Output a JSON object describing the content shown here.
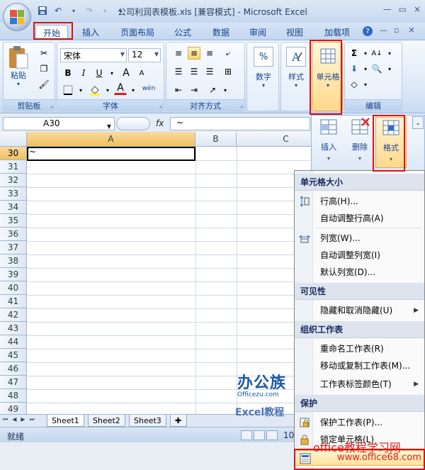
{
  "title_bar": {
    "title": "公司利润表模板.xls [兼容模式] - Microsoft Excel",
    "minimize": "—",
    "restore": "▭",
    "close": "×"
  },
  "tabs": [
    {
      "label": "开始",
      "active": true
    },
    {
      "label": "插入",
      "active": false
    },
    {
      "label": "页面布局",
      "active": false
    },
    {
      "label": "公式",
      "active": false
    },
    {
      "label": "数据",
      "active": false
    },
    {
      "label": "审阅",
      "active": false
    },
    {
      "label": "视图",
      "active": false
    },
    {
      "label": "加载项",
      "active": false
    }
  ],
  "ribbon": {
    "clipboard": {
      "label": "剪贴板",
      "paste": "粘贴"
    },
    "font": {
      "label": "字体",
      "font_name": "宋体",
      "font_size": "12",
      "bold": "B",
      "italic": "I",
      "underline": "U",
      "grow": "A",
      "shrink": "A",
      "font_color_letter": "A",
      "phonetic": "wén"
    },
    "alignment": {
      "label": "对齐方式"
    },
    "number": {
      "label": "数字",
      "symbol": "%"
    },
    "styles": {
      "label": "样式"
    },
    "cells": {
      "label": "单元格"
    },
    "editing": {
      "label": "编辑"
    }
  },
  "formula_bar": {
    "name_box": "A30",
    "fx": "fx",
    "content": "~"
  },
  "cells_panel": {
    "insert": "插入",
    "delete": "删除",
    "format": "格式"
  },
  "grid": {
    "columns": [
      "A",
      "B",
      "C"
    ],
    "rows": [
      "30",
      "31",
      "32",
      "33",
      "34",
      "35",
      "36",
      "37",
      "38",
      "39",
      "40",
      "41",
      "42",
      "43",
      "44",
      "45",
      "46",
      "47",
      "48",
      "49"
    ],
    "active_cell_value": "~"
  },
  "sheets": [
    "Sheet1",
    "Sheet2",
    "Sheet3"
  ],
  "status": {
    "text": "就绪",
    "zoom": "10"
  },
  "menu": {
    "sections": {
      "cell_size": "单元格大小",
      "visibility": "可见性",
      "organize": "组织工作表",
      "protect": "保护"
    },
    "items": {
      "row_height": "行高(H)...",
      "autofit_row": "自动调整行高(A)",
      "col_width": "列宽(W)...",
      "autofit_col": "自动调整列宽(I)",
      "default_width": "默认列宽(D)...",
      "hide_unhide": "隐藏和取消隐藏(U)",
      "rename": "重命名工作表(R)",
      "move_copy": "移动或复制工作表(M)...",
      "tab_color": "工作表标签颜色(T)",
      "protect_sheet": "保护工作表(P)...",
      "lock_cell": "锁定单元格(L)"
    }
  },
  "watermarks": {
    "brand1": "办公族",
    "brand1_url": "Officezu.com",
    "brand2": "Excel教程",
    "brand3": "office教程学习网",
    "brand3_url": "www.office68.com"
  }
}
